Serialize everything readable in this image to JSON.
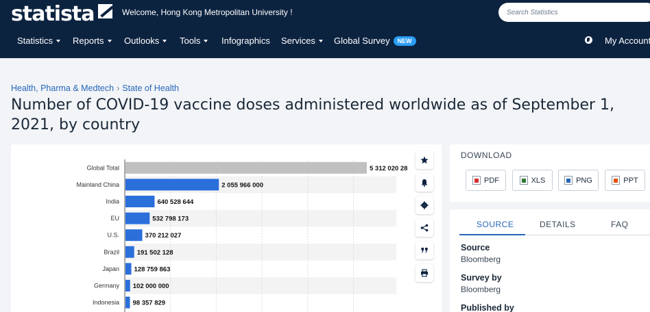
{
  "header": {
    "logo_text": "statista",
    "welcome": "Welcome, Hong Kong Metropolitan University !",
    "search_placeholder": "Search Statistics"
  },
  "nav": {
    "items": [
      {
        "label": "Statistics",
        "dropdown": true
      },
      {
        "label": "Reports",
        "dropdown": true
      },
      {
        "label": "Outlooks",
        "dropdown": true
      },
      {
        "label": "Tools",
        "dropdown": true
      },
      {
        "label": "Infographics",
        "dropdown": false
      },
      {
        "label": "Services",
        "dropdown": true
      },
      {
        "label": "Global Survey",
        "dropdown": false
      }
    ],
    "new_badge": "NEW",
    "account": "My Account"
  },
  "breadcrumb": [
    "Health, Pharma & Medtech",
    "State of Health"
  ],
  "page_title": "Number of COVID-19 vaccine doses administered worldwide as of September 1, 2021, by country",
  "chart_data": {
    "type": "bar",
    "orientation": "horizontal",
    "categories": [
      "Global Total",
      "Mainland China",
      "India",
      "EU",
      "U.S.",
      "Brazil",
      "Japan",
      "Germany",
      "Indonesia"
    ],
    "values": [
      5312020280,
      2055966000,
      640528644,
      532798173,
      370212027,
      191502128,
      128759863,
      102000000,
      98357829
    ],
    "value_labels": [
      "5 312 020 28",
      "2 055 966 000",
      "640 528 644",
      "532 798 173",
      "370 212 027",
      "191 502 128",
      "128 759 863",
      "102 000 000",
      "98 357 829"
    ],
    "highlight_colors": [
      "#c0c0c0",
      "#2b6fdb",
      "#2b6fdb",
      "#2b6fdb",
      "#2b6fdb",
      "#2b6fdb",
      "#2b6fdb",
      "#2b6fdb",
      "#2b6fdb"
    ],
    "grid": true
  },
  "side_buttons": [
    "star-icon",
    "bell-icon",
    "gear-icon",
    "share-icon",
    "quote-icon",
    "print-icon"
  ],
  "download": {
    "title": "DOWNLOAD",
    "buttons": [
      "PDF",
      "XLS",
      "PNG",
      "PPT"
    ]
  },
  "source_panel": {
    "tabs": [
      "SOURCE",
      "DETAILS",
      "FAQ"
    ],
    "source_label": "Source",
    "source_value": "Bloomberg",
    "survey_label": "Survey by",
    "survey_value": "Bloomberg",
    "published_label": "Published by"
  }
}
